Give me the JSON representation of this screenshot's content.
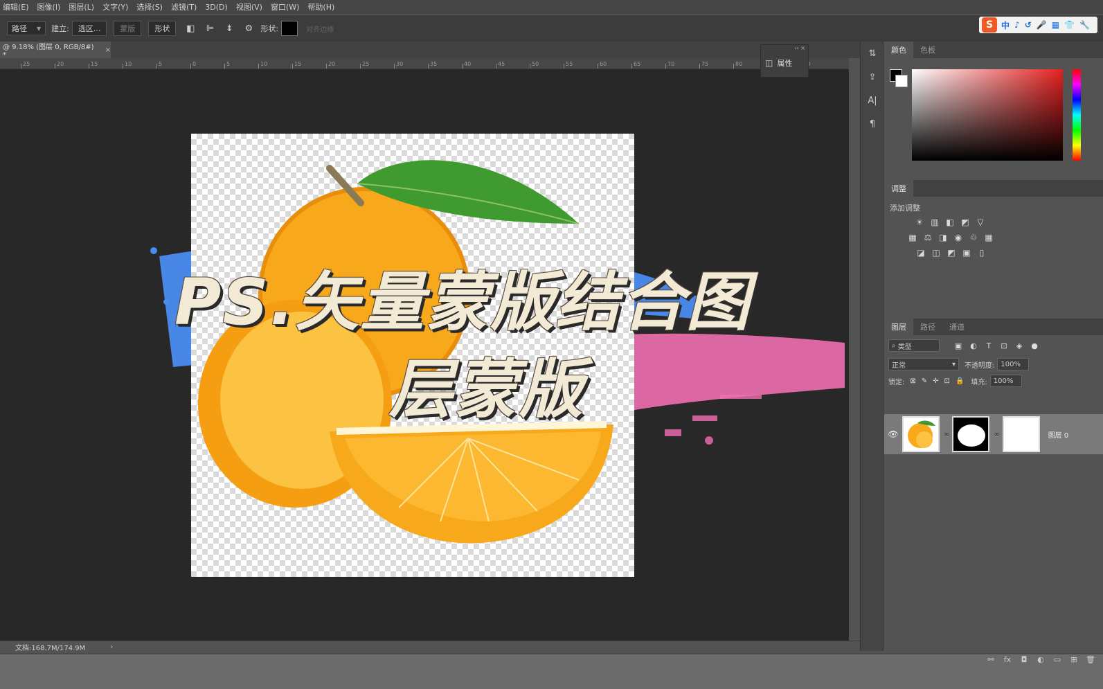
{
  "menu": [
    "编辑(E)",
    "图像(I)",
    "图层(L)",
    "文字(Y)",
    "选择(S)",
    "滤镜(T)",
    "3D(D)",
    "视图(V)",
    "窗口(W)",
    "帮助(H)"
  ],
  "options": {
    "mode": "路径",
    "make_label": "建立:",
    "selection_btn": "选区...",
    "mask_btn": "蒙版",
    "shape_btn": "形状",
    "shape_label": "形状:",
    "align_edges": "对齐边缘"
  },
  "ime": {
    "logo": "S",
    "items": [
      "中",
      "♪",
      "↺",
      "🎤",
      "▦",
      "👕",
      "🔧"
    ]
  },
  "doc_tab": {
    "title": "@ 9.18% (图层 0, RGB/8#) *",
    "close": "×"
  },
  "ruler": [
    "25",
    "20",
    "15",
    "10",
    "5",
    "0",
    "5",
    "10",
    "15",
    "20",
    "25",
    "30",
    "35",
    "40",
    "45",
    "50",
    "55",
    "60",
    "65",
    "70",
    "75",
    "80",
    "85",
    "90"
  ],
  "overlay": {
    "line1": "PS.矢量蒙版结合图",
    "line2": "层蒙版"
  },
  "status": {
    "doc_size": "文档:168.7M/174.9M",
    "arrow": "›"
  },
  "properties_panel": {
    "label": "属性",
    "icon": "◫",
    "controls": "‹‹ ×"
  },
  "color_panel": {
    "tabs": [
      "颜色",
      "色板"
    ]
  },
  "adjust_panel": {
    "tab": "调整",
    "add_label": "添加调整",
    "row1": [
      "☀",
      "▥",
      "◧",
      "◩",
      "▽"
    ],
    "row2": [
      "▦",
      "⚖",
      "◨",
      "◉",
      "♲",
      "▦"
    ],
    "row3": [
      "◪",
      "◫",
      "◩",
      "▣",
      "▯"
    ]
  },
  "layers_panel": {
    "tabs": [
      "图层",
      "路径",
      "通道"
    ],
    "filter_label": "类型",
    "filter_icons": [
      "▣",
      "◐",
      "T",
      "⊡",
      "◈",
      "●"
    ],
    "blend_mode": "正常",
    "opacity_label": "不透明度:",
    "opacity": "100%",
    "lock_label": "锁定:",
    "fill_label": "填充:",
    "fill": "100%",
    "layer_name": "图层 0",
    "bottom_icons": [
      "⚯",
      "fx",
      "◘",
      "◐",
      "▭",
      "⊞",
      "🗑"
    ]
  },
  "tool_strip": [
    "⇅",
    "⇪",
    "A|",
    "¶"
  ],
  "colors": {
    "accent_blue": "#4a8cf0",
    "accent_pink": "#ef6fb0",
    "orange": "#f7a81b",
    "leaf": "#3f9a2f"
  }
}
